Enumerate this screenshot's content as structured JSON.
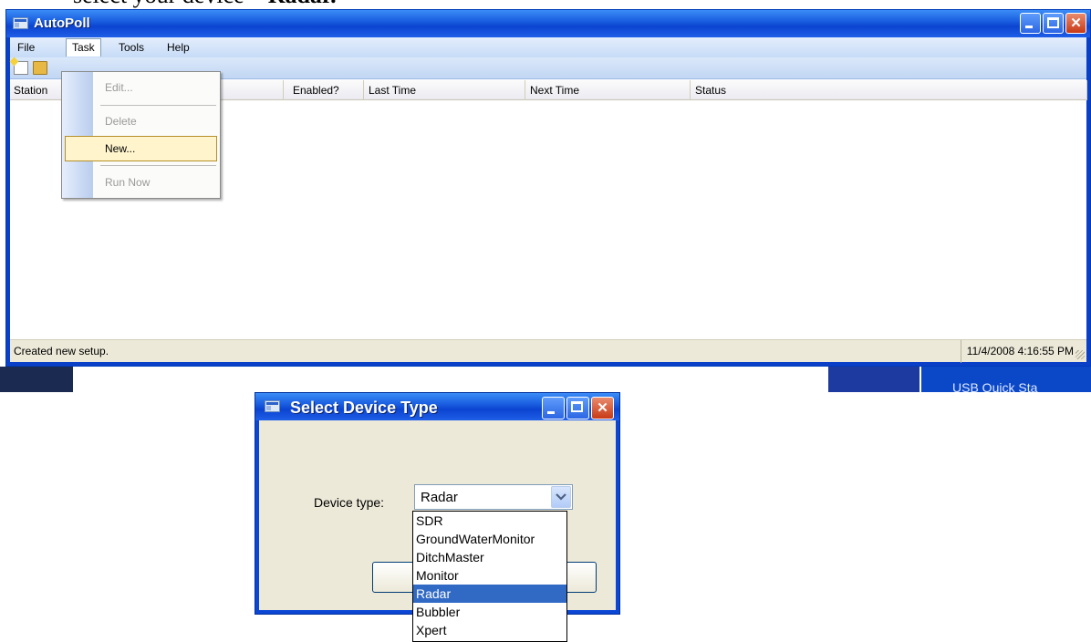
{
  "doc": {
    "text_prefix": "select your device – ",
    "text_bold": "Radar."
  },
  "window": {
    "title": "AutoPoll",
    "menu": [
      "File",
      "Task",
      "Tools",
      "Help"
    ],
    "columns": [
      "Station",
      "Enabled?",
      "Last Time",
      "Next Time",
      "Status"
    ],
    "status_left": "Created new setup.",
    "status_right": "11/4/2008 4:16:55 PM"
  },
  "task_menu": {
    "items": [
      {
        "label": "Edit...",
        "state": "disabled"
      },
      {
        "label": "Delete",
        "state": "disabled"
      },
      {
        "label": "New...",
        "state": "hover"
      },
      {
        "label": "Run Now",
        "state": "disabled"
      }
    ]
  },
  "dialog": {
    "title": "Select Device Type",
    "label": "Device type:",
    "selected": "Radar",
    "options": [
      "SDR",
      "GroundWaterMonitor",
      "DitchMaster",
      "Monitor",
      "Radar",
      "Bubbler",
      "Xpert"
    ]
  },
  "background_fragment": "USB Quick Sta",
  "colors": {
    "title_blue": "#0b44d0",
    "selection": "#316ac5",
    "menu_hover": "#fff4cc"
  }
}
